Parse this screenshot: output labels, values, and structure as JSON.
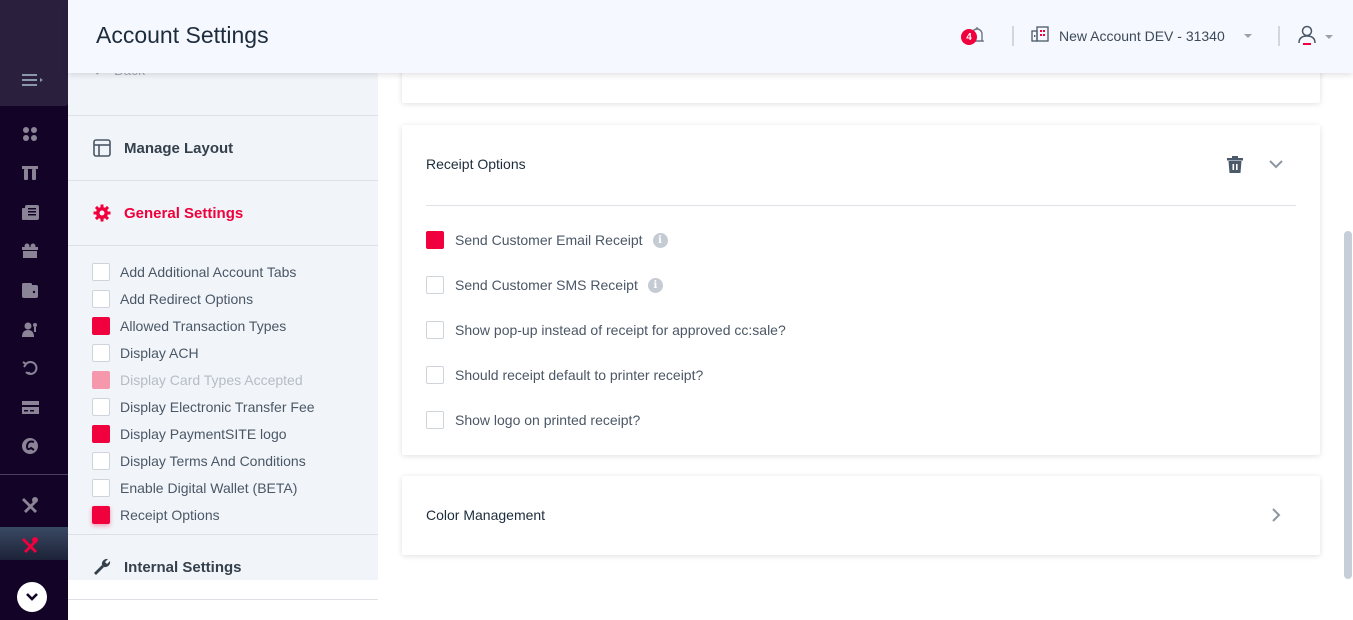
{
  "header": {
    "title": "Account Settings",
    "notifications_count": "4",
    "account_name": "New Account DEV - 31340",
    "icons": {
      "notifications": "bell-icon",
      "account": "building-icon",
      "account_caret": "caret-down-icon",
      "user": "user-icon",
      "user_caret": "caret-down-icon"
    }
  },
  "rail": {
    "items": [
      {
        "icon": "menu-toggle-icon"
      },
      {
        "icon": "dashboard-icon"
      },
      {
        "icon": "pos-terminal-icon"
      },
      {
        "icon": "reports-icon"
      },
      {
        "icon": "gift-icon"
      },
      {
        "icon": "wallet-icon"
      },
      {
        "icon": "customers-icon"
      },
      {
        "icon": "refund-icon"
      },
      {
        "icon": "card-icon"
      },
      {
        "icon": "fees-icon"
      },
      {
        "icon": "tools-icon"
      },
      {
        "icon": "settings-tools-icon",
        "active": true
      },
      {
        "icon": "expand-icon"
      }
    ]
  },
  "panel": {
    "back_label": "Back",
    "sections": [
      {
        "label": "Manage Layout",
        "icon": "layout-icon",
        "active": false
      },
      {
        "label": "General Settings",
        "icon": "gear-icon",
        "active": true
      },
      {
        "label": "Internal Settings",
        "icon": "wrench-icon",
        "active": false
      }
    ],
    "options": [
      {
        "label": "Add Additional Account Tabs",
        "checked": false,
        "disabled": false
      },
      {
        "label": "Add Redirect Options",
        "checked": false,
        "disabled": false
      },
      {
        "label": "Allowed Transaction Types",
        "checked": true,
        "disabled": false
      },
      {
        "label": "Display ACH",
        "checked": false,
        "disabled": false
      },
      {
        "label": "Display Card Types Accepted",
        "checked": true,
        "disabled": true
      },
      {
        "label": "Display Electronic Transfer Fee",
        "checked": false,
        "disabled": false
      },
      {
        "label": "Display PaymentSITE logo",
        "checked": true,
        "disabled": false
      },
      {
        "label": "Display Terms And Conditions",
        "checked": false,
        "disabled": false
      },
      {
        "label": "Enable Digital Wallet (BETA)",
        "checked": false,
        "disabled": false
      },
      {
        "label": "Receipt Options",
        "checked": true,
        "disabled": false
      }
    ]
  },
  "main": {
    "receipt_card": {
      "title": "Receipt Options",
      "delete_icon": "trash-icon",
      "collapse_icon": "chevron-down-icon",
      "options": [
        {
          "label": "Send Customer Email Receipt",
          "checked": true,
          "info": true
        },
        {
          "label": "Send Customer SMS Receipt",
          "checked": false,
          "info": true
        },
        {
          "label": "Show pop-up instead of receipt for approved cc:sale?",
          "checked": false,
          "info": false
        },
        {
          "label": "Should receipt default to printer receipt?",
          "checked": false,
          "info": false
        },
        {
          "label": "Show logo on printed receipt?",
          "checked": false,
          "info": false
        }
      ],
      "info_glyph": "i"
    },
    "color_card": {
      "title": "Color Management",
      "expand_icon": "chevron-right-icon"
    }
  },
  "colors": {
    "accent": "#f0003c",
    "rail_bg": "#130427",
    "panel_bg": "#f1f5f9",
    "header_bg": "#f5f8fe"
  }
}
